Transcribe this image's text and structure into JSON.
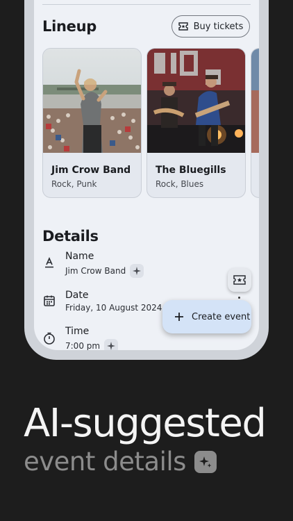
{
  "lineup": {
    "title": "Lineup",
    "buy_tickets_label": "Buy tickets",
    "cards": [
      {
        "name": "Jim Crow Band",
        "genre": "Rock, Punk"
      },
      {
        "name": "The Bluegills",
        "genre": "Rock, Blues"
      }
    ]
  },
  "details": {
    "title": "Details",
    "fields": [
      {
        "label": "Name",
        "value": "Jim Crow Band",
        "icon": "text-format-icon"
      },
      {
        "label": "Date",
        "value": "Friday, 10 August 2024",
        "icon": "calendar-icon"
      },
      {
        "label": "Time",
        "value": "7:00 pm",
        "icon": "timer-icon"
      }
    ]
  },
  "fab": {
    "label": "Create event",
    "icon": "plus-icon"
  },
  "mini_fab": {
    "icon": "ticket-icon"
  },
  "promo": {
    "headline": "AI-suggested",
    "subline": "event details"
  },
  "colors": {
    "background": "#1d1d1d",
    "screen": "#eef1f6",
    "fab": "#d4e3f7"
  }
}
